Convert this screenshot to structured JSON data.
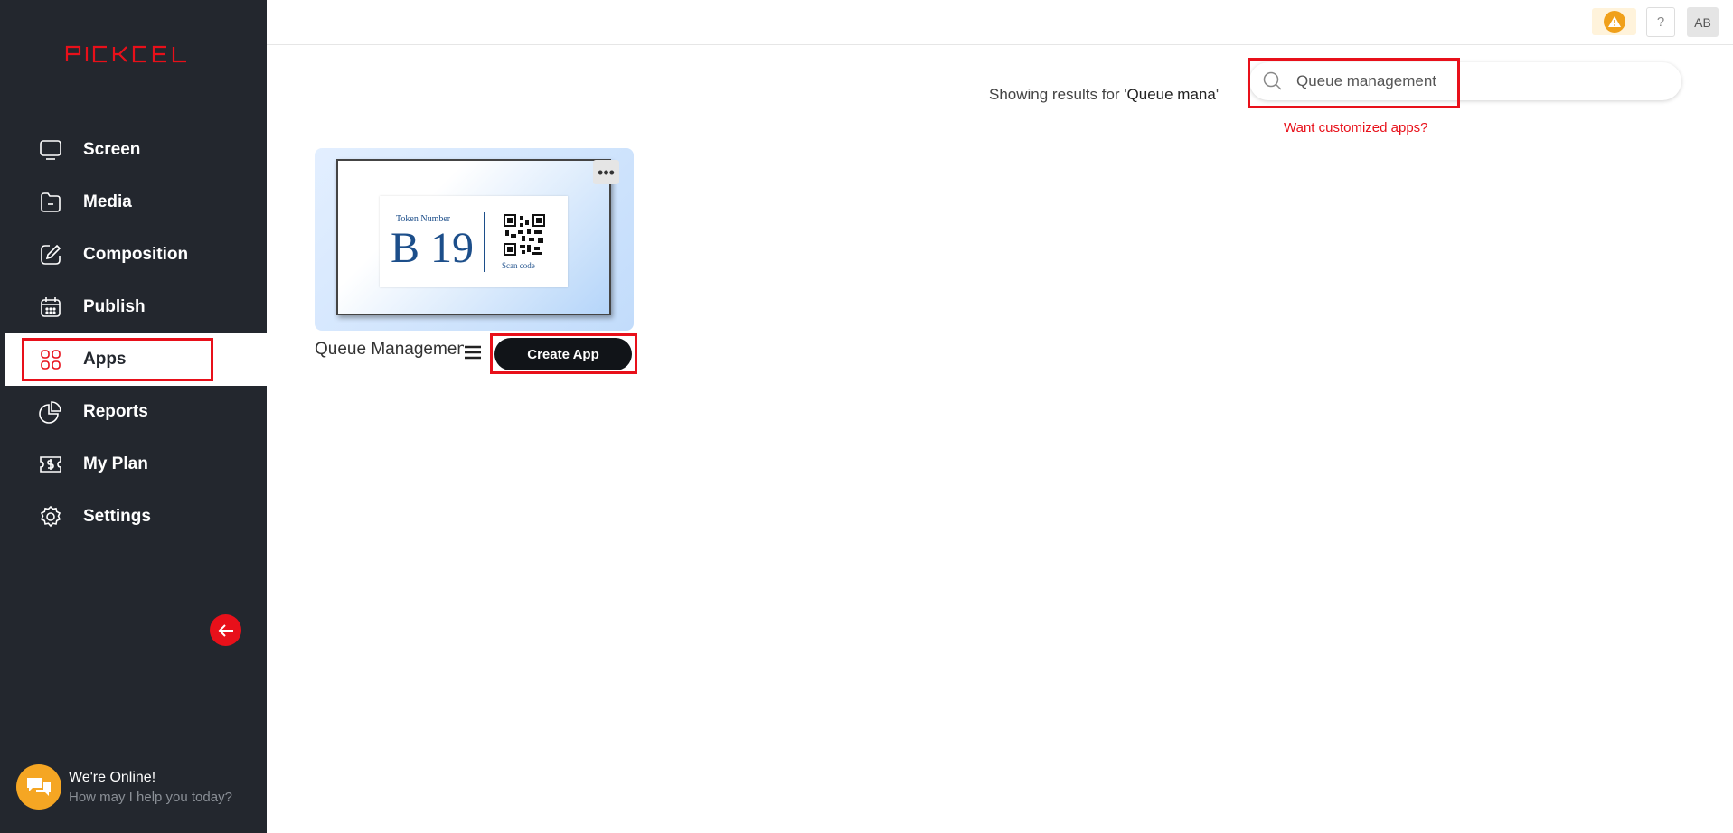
{
  "brand": {
    "logo_text": "PICKCEL",
    "accent_color": "#e8101a"
  },
  "sidebar": {
    "items": [
      {
        "label": "Screen",
        "icon": "monitor-icon"
      },
      {
        "label": "Media",
        "icon": "folder-icon"
      },
      {
        "label": "Composition",
        "icon": "edit-icon"
      },
      {
        "label": "Publish",
        "icon": "calendar-icon"
      },
      {
        "label": "Apps",
        "icon": "apps-grid-icon",
        "active": true
      },
      {
        "label": "Reports",
        "icon": "pie-chart-icon"
      },
      {
        "label": "My Plan",
        "icon": "dollar-ticket-icon"
      },
      {
        "label": "Settings",
        "icon": "gear-icon"
      }
    ],
    "collapse_icon": "arrow-left-icon"
  },
  "chat": {
    "title": "We're Online!",
    "subtitle": "How may I help you today?",
    "icon": "chat-icon"
  },
  "header": {
    "help_label": "?",
    "avatar_initials": "AB",
    "warning_icon": "warning-icon"
  },
  "search": {
    "results_prefix": "Showing results for '",
    "results_query": "Queue mana",
    "results_suffix": "'",
    "value": "Queue management",
    "custom_link": "Want customized apps?"
  },
  "app_card": {
    "title": "Queue Management",
    "more_label": "•••",
    "create_label": "Create App",
    "preview": {
      "token_label": "Token Number",
      "token_number": "B 19",
      "scan_label": "Scan code"
    }
  }
}
